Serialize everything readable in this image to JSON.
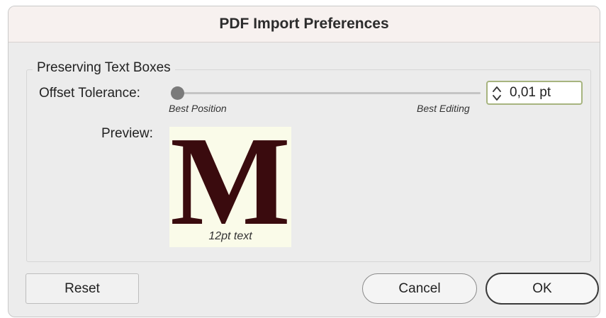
{
  "dialog": {
    "title": "PDF Import Preferences"
  },
  "group": {
    "label": "Preserving Text Boxes"
  },
  "offset_tolerance": {
    "label": "Offset Tolerance:",
    "slider_min_label": "Best Position",
    "slider_max_label": "Best Editing",
    "slider_level": 0.0,
    "value": "0,01 pt",
    "stepper_icon": "up-down-chevrons-icon"
  },
  "preview": {
    "label": "Preview:",
    "letter": "M",
    "caption": "12pt text",
    "background_color": "#fafbe9",
    "letter_color": "#3a0b0e"
  },
  "buttons": {
    "reset": "Reset",
    "cancel": "Cancel",
    "ok": "OK"
  },
  "colors": {
    "accent_field_border": "#a7b47f"
  }
}
